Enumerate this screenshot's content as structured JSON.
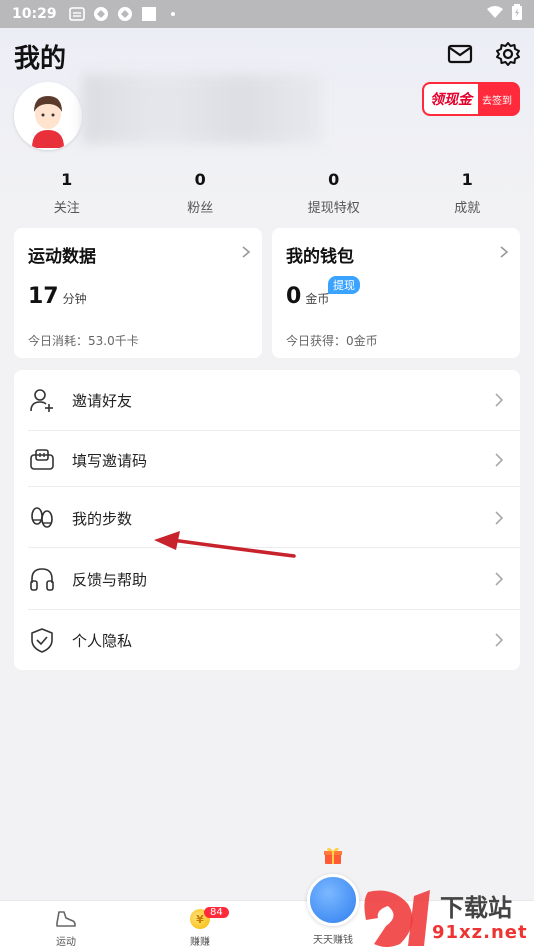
{
  "status_bar": {
    "time": "10:29"
  },
  "page": {
    "title": "我的"
  },
  "cash_button": {
    "main": "领现金",
    "sub": "去签到"
  },
  "stats": [
    {
      "value": "1",
      "label": "关注"
    },
    {
      "value": "0",
      "label": "粉丝"
    },
    {
      "value": "0",
      "label": "提现特权"
    },
    {
      "value": "1",
      "label": "成就"
    }
  ],
  "sport_card": {
    "title": "运动数据",
    "value": "17",
    "unit": "分钟",
    "sub": "今日消耗：53.0千卡"
  },
  "wallet_card": {
    "title": "我的钱包",
    "value": "0",
    "unit": "金币",
    "badge": "提现",
    "sub": "今日获得：0金币"
  },
  "menu": [
    {
      "label": "邀请好友",
      "icon": "add-user-icon"
    },
    {
      "label": "填写邀请码",
      "icon": "ticket-icon"
    },
    {
      "label": "我的步数",
      "icon": "footprints-icon"
    },
    {
      "label": "反馈与帮助",
      "icon": "headphones-icon"
    },
    {
      "label": "个人隐私",
      "icon": "shield-check-icon"
    }
  ],
  "bottom_nav": {
    "sport": "运动",
    "earn": "赚赚",
    "earn_badge": "84",
    "daily": "天天赚钱"
  },
  "watermark": {
    "title": "下载站",
    "url": "91xz.net"
  },
  "colors": {
    "accent_red": "#ff2b3d",
    "badge_blue": "#3aa3ff",
    "center_blue": "#2f7ff0"
  }
}
